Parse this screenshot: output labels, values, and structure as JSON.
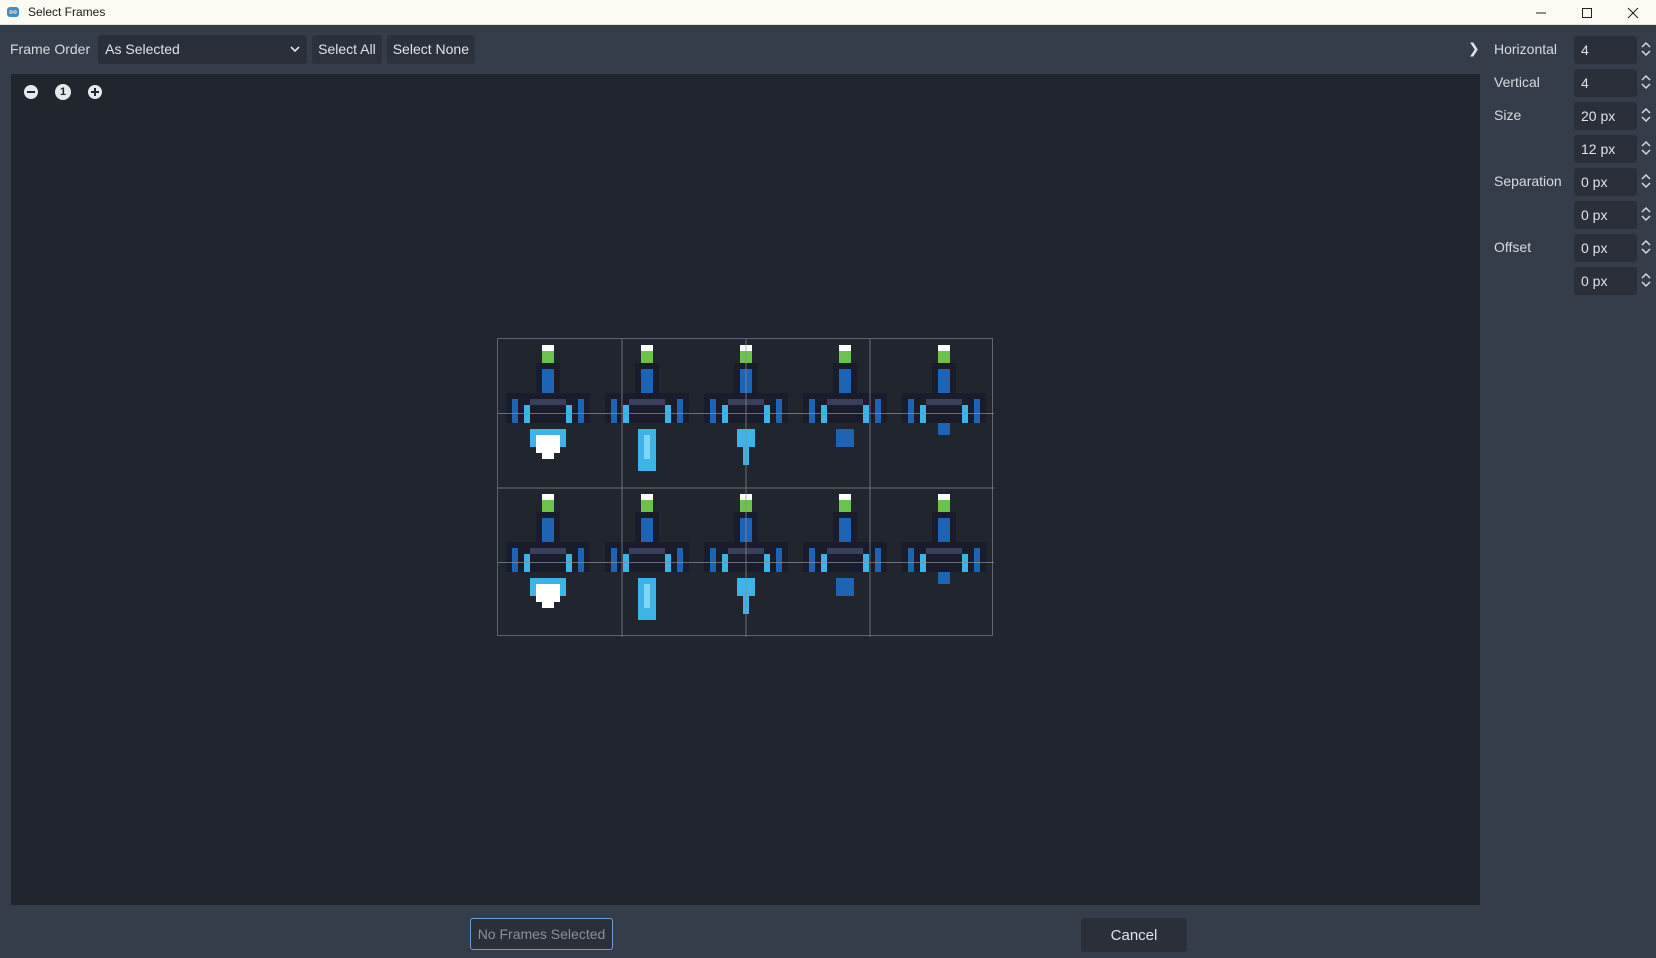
{
  "window": {
    "title": "Select Frames",
    "minimize_icon": "minimize-icon",
    "maximize_icon": "maximize-icon",
    "close_icon": "close-icon"
  },
  "toolbar": {
    "frame_order_label": "Frame Order",
    "frame_order_value": "As Selected",
    "select_all_label": "Select All",
    "select_none_label": "Select None",
    "collapse_glyph": "❯"
  },
  "zoom": {
    "zoom_out_icon": "zoom-out-icon",
    "zoom_reset_label": "1",
    "zoom_in_icon": "zoom-in-icon"
  },
  "panel": {
    "horizontal_label": "Horizontal",
    "horizontal_value": "4",
    "vertical_label": "Vertical",
    "vertical_value": "4",
    "size_label": "Size",
    "size_x": "20 px",
    "size_y": "12 px",
    "separation_label": "Separation",
    "separation_x": "0 px",
    "separation_y": "0 px",
    "offset_label": "Offset",
    "offset_x": "0 px",
    "offset_y": "0 px"
  },
  "footer": {
    "no_frames_label": "No Frames Selected",
    "cancel_label": "Cancel"
  },
  "colors": {
    "canvas_bg": "#21252d",
    "panel_bg": "#363d4a",
    "accent": "#6d9cd3",
    "ship_dark": "#1a1c2c",
    "ship_blue": "#1e64b4",
    "ship_light": "#3cb4e6",
    "cockpit_green": "#6cc24a",
    "flame_white": "#ffffff"
  }
}
